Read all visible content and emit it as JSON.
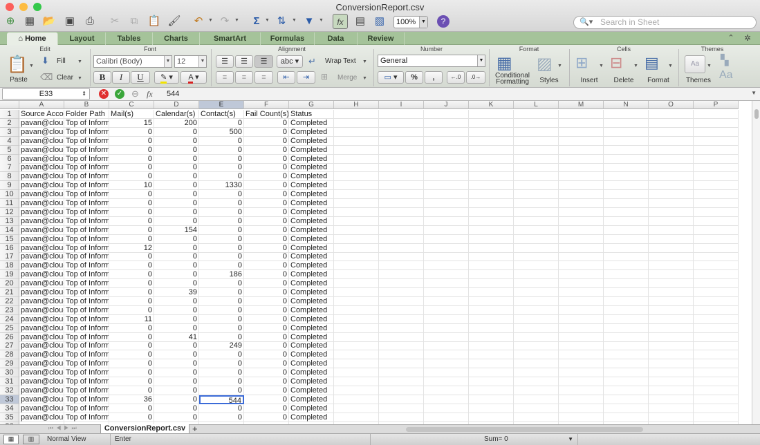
{
  "window": {
    "title": "ConversionReport.csv"
  },
  "toolbar": {
    "zoom": "100%",
    "search_placeholder": "Search in Sheet"
  },
  "tabs": [
    "Home",
    "Layout",
    "Tables",
    "Charts",
    "SmartArt",
    "Formulas",
    "Data",
    "Review"
  ],
  "ribbon": {
    "groups": {
      "edit": "Edit",
      "font": "Font",
      "alignment": "Alignment",
      "number": "Number",
      "format": "Format",
      "cells": "Cells",
      "themes": "Themes"
    },
    "paste": "Paste",
    "fill": "Fill",
    "clear": "Clear",
    "font_name": "Calibri (Body)",
    "font_size": "12",
    "bold": "B",
    "italic": "I",
    "underline": "U",
    "wrap_text": "Wrap Text",
    "merge": "Merge",
    "abc": "abc",
    "number_format": "General",
    "percent": "%",
    "comma": ",",
    "conditional_formatting": [
      "Conditional",
      "Formatting"
    ],
    "styles": "Styles",
    "insert": "Insert",
    "delete": "Delete",
    "format": "Format",
    "themes": "Themes",
    "aa": "Aa"
  },
  "formula_bar": {
    "cell_ref": "E33",
    "fx": "fx",
    "value": "544"
  },
  "columns": [
    "A",
    "B",
    "C",
    "D",
    "E",
    "F",
    "G",
    "H",
    "I",
    "J",
    "K",
    "L",
    "M",
    "N",
    "O",
    "P"
  ],
  "selected": {
    "column": "E",
    "row": 33
  },
  "header_row": [
    "Source Account",
    "Folder Path",
    "Mail(s)",
    "Calendar(s)",
    "Contact(s)",
    "Fail Count(s)",
    "Status"
  ],
  "rows": [
    [
      "pavan@cloud",
      "Top of Information Store",
      "15",
      "200",
      "0",
      "0",
      "Completed"
    ],
    [
      "pavan@cloud",
      "Top of Information Store",
      "0",
      "0",
      "500",
      "0",
      "Completed"
    ],
    [
      "pavan@cloud",
      "Top of Information Store",
      "0",
      "0",
      "0",
      "0",
      "Completed"
    ],
    [
      "pavan@cloud",
      "Top of Information Store",
      "0",
      "0",
      "0",
      "0",
      "Completed"
    ],
    [
      "pavan@cloud",
      "Top of Information Store",
      "0",
      "0",
      "0",
      "0",
      "Completed"
    ],
    [
      "pavan@cloud",
      "Top of Information Store",
      "0",
      "0",
      "0",
      "0",
      "Completed"
    ],
    [
      "pavan@cloud",
      "Top of Information Store",
      "0",
      "0",
      "0",
      "0",
      "Completed"
    ],
    [
      "pavan@cloud",
      "Top of Information Store",
      "10",
      "0",
      "1330",
      "0",
      "Completed"
    ],
    [
      "pavan@cloud",
      "Top of Information Store",
      "0",
      "0",
      "0",
      "0",
      "Completed"
    ],
    [
      "pavan@cloud",
      "Top of Information Store",
      "0",
      "0",
      "0",
      "0",
      "Completed"
    ],
    [
      "pavan@cloud",
      "Top of Information Store",
      "0",
      "0",
      "0",
      "0",
      "Completed"
    ],
    [
      "pavan@cloud",
      "Top of Information Store",
      "0",
      "0",
      "0",
      "0",
      "Completed"
    ],
    [
      "pavan@cloud",
      "Top of Information Store",
      "0",
      "154",
      "0",
      "0",
      "Completed"
    ],
    [
      "pavan@cloud",
      "Top of Information Store",
      "0",
      "0",
      "0",
      "0",
      "Completed"
    ],
    [
      "pavan@cloud",
      "Top of Information Store",
      "12",
      "0",
      "0",
      "0",
      "Completed"
    ],
    [
      "pavan@cloud",
      "Top of Information Store",
      "0",
      "0",
      "0",
      "0",
      "Completed"
    ],
    [
      "pavan@cloud",
      "Top of Information Store",
      "0",
      "0",
      "0",
      "0",
      "Completed"
    ],
    [
      "pavan@cloud",
      "Top of Information Store",
      "0",
      "0",
      "186",
      "0",
      "Completed"
    ],
    [
      "pavan@cloud",
      "Top of Information Store",
      "0",
      "0",
      "0",
      "0",
      "Completed"
    ],
    [
      "pavan@cloud",
      "Top of Information Store",
      "0",
      "39",
      "0",
      "0",
      "Completed"
    ],
    [
      "pavan@cloud",
      "Top of Information Store",
      "0",
      "0",
      "0",
      "0",
      "Completed"
    ],
    [
      "pavan@cloud",
      "Top of Information Store",
      "0",
      "0",
      "0",
      "0",
      "Completed"
    ],
    [
      "pavan@cloud",
      "Top of Information Store",
      "11",
      "0",
      "0",
      "0",
      "Completed"
    ],
    [
      "pavan@cloud",
      "Top of Information Store",
      "0",
      "0",
      "0",
      "0",
      "Completed"
    ],
    [
      "pavan@cloud",
      "Top of Information Store",
      "0",
      "41",
      "0",
      "0",
      "Completed"
    ],
    [
      "pavan@cloud",
      "Top of Information Store",
      "0",
      "0",
      "249",
      "0",
      "Completed"
    ],
    [
      "pavan@cloud",
      "Top of Information Store",
      "0",
      "0",
      "0",
      "0",
      "Completed"
    ],
    [
      "pavan@cloud",
      "Top of Information Store",
      "0",
      "0",
      "0",
      "0",
      "Completed"
    ],
    [
      "pavan@cloud",
      "Top of Information Store",
      "0",
      "0",
      "0",
      "0",
      "Completed"
    ],
    [
      "pavan@cloud",
      "Top of Information Store",
      "0",
      "0",
      "0",
      "0",
      "Completed"
    ],
    [
      "pavan@cloud",
      "Top of Information Store",
      "0",
      "0",
      "0",
      "0",
      "Completed"
    ],
    [
      "pavan@cloud",
      "Top of Information Store",
      "36",
      "0",
      "544",
      "0",
      "Completed"
    ],
    [
      "pavan@cloud",
      "Top of Information Store",
      "0",
      "0",
      "0",
      "0",
      "Completed"
    ],
    [
      "pavan@cloud",
      "Top of Information Store",
      "0",
      "0",
      "0",
      "0",
      "Completed"
    ]
  ],
  "sheet_tab": "ConversionReport.csv",
  "status": {
    "view": "Normal View",
    "mode": "Enter",
    "sum": "Sum= 0"
  },
  "colors": {
    "tab_bar": "#a5c39a",
    "selection": "#3b6bd8",
    "header_selected": "#bfc8d8"
  }
}
